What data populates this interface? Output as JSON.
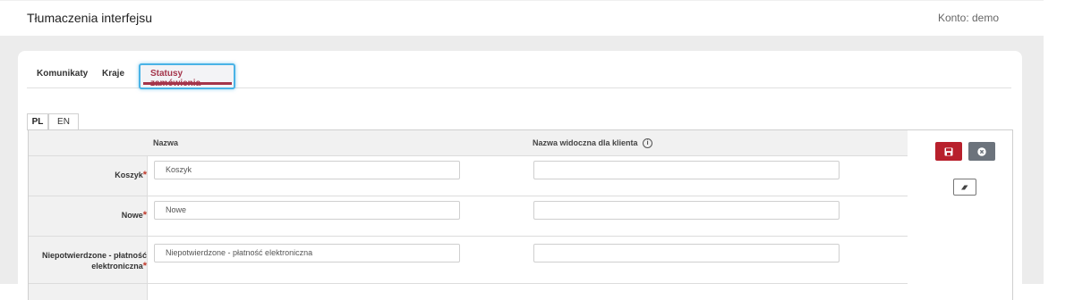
{
  "header": {
    "title": "Tłumaczenia interfejsu",
    "account": "Konto: demo"
  },
  "tabs": [
    {
      "label": "Komunikaty",
      "active": false
    },
    {
      "label": "Kraje",
      "active": false
    },
    {
      "label": "Statusy zamówienia",
      "active": true
    }
  ],
  "languages": [
    {
      "label": "PL",
      "active": true
    },
    {
      "label": "EN",
      "active": false
    }
  ],
  "table": {
    "columns": [
      "Nazwa",
      "Nazwa widoczna dla klienta"
    ],
    "rows": [
      {
        "label": "Koszyk",
        "required": "*",
        "name_value": "Koszyk",
        "client_name_value": ""
      },
      {
        "label": "Nowe",
        "required": "*",
        "name_value": "Nowe",
        "client_name_value": ""
      },
      {
        "label": "Niepotwierdzone - płatność elektroniczna",
        "required": "*",
        "name_value": "Niepotwierdzone - płatność elektroniczna",
        "client_name_value": ""
      }
    ]
  },
  "actions": {
    "save_icon": "floppy-disk-icon",
    "cancel_icon": "close-circle-icon",
    "erase_icon": "eraser-icon"
  },
  "colors": {
    "accent": "#a4344a",
    "save": "#b8202c",
    "cancel": "#6c737c",
    "focus": "#4ab3e6"
  }
}
